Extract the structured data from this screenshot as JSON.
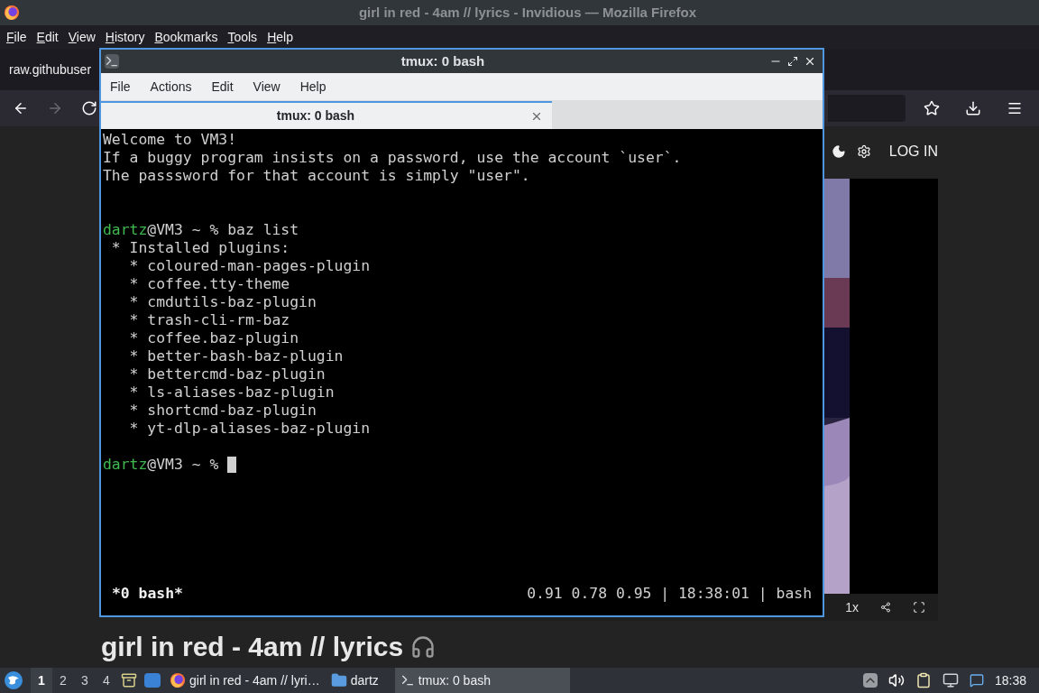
{
  "firefox": {
    "title": "girl in red - 4am // lyrics - Invidious — Mozilla Firefox",
    "menu": [
      "File",
      "Edit",
      "View",
      "History",
      "Bookmarks",
      "Tools",
      "Help"
    ],
    "tab": "raw.githubuser",
    "nav_buttons": [
      {
        "kind": "back",
        "disabled": false
      },
      {
        "kind": "forward",
        "disabled": true
      },
      {
        "kind": "reload",
        "disabled": false
      }
    ],
    "page": {
      "login": "LOG IN",
      "speed": "1x",
      "heading": "girl in red - 4am // lyrics"
    }
  },
  "terminal": {
    "title": "tmux: 0 bash",
    "menu": [
      "File",
      "Actions",
      "Edit",
      "View",
      "Help"
    ],
    "tab": {
      "label": "tmux: 0 bash",
      "selected": true
    },
    "lines": [
      {
        "kind": "output",
        "text": "Welcome to VM3!"
      },
      {
        "kind": "output",
        "text": "If a buggy program insists on a password, use the account `user`."
      },
      {
        "kind": "output",
        "text": "The passsword for that account is simply \"user\"."
      },
      {
        "kind": "blank"
      },
      {
        "kind": "blank"
      },
      {
        "kind": "prompt",
        "user": "dartz",
        "text": "@VM3 ~ % baz list",
        "cursor": false
      },
      {
        "kind": "output",
        "text": " * Installed plugins:"
      },
      {
        "kind": "output",
        "text": "   * coloured-man-pages-plugin"
      },
      {
        "kind": "output",
        "text": "   * coffee.tty-theme"
      },
      {
        "kind": "output",
        "text": "   * cmdutils-baz-plugin"
      },
      {
        "kind": "output",
        "text": "   * trash-cli-rm-baz"
      },
      {
        "kind": "output",
        "text": "   * coffee.baz-plugin"
      },
      {
        "kind": "output",
        "text": "   * better-bash-baz-plugin"
      },
      {
        "kind": "output",
        "text": "   * bettercmd-baz-plugin"
      },
      {
        "kind": "output",
        "text": "   * ls-aliases-baz-plugin"
      },
      {
        "kind": "output",
        "text": "   * shortcmd-baz-plugin"
      },
      {
        "kind": "output",
        "text": "   * yt-dlp-aliases-baz-plugin"
      },
      {
        "kind": "blank"
      },
      {
        "kind": "prompt",
        "user": "dartz",
        "text": "@VM3 ~ % ",
        "cursor": true
      }
    ],
    "status": {
      "window": "*0 bash*",
      "right": "0.91 0.78 0.95 | 18:38:01 | bash"
    }
  },
  "taskbar": {
    "workspaces": [
      {
        "label": "1",
        "selected": true
      },
      {
        "label": "2",
        "selected": false
      },
      {
        "label": "3",
        "selected": false
      },
      {
        "label": "4",
        "selected": false
      }
    ],
    "tasks": [
      {
        "kind": "firefox",
        "label": "girl in red - 4am // lyri…",
        "selected": false
      },
      {
        "kind": "folder",
        "label": "dartz",
        "selected": false
      },
      {
        "kind": "terminal",
        "label": "tmux: 0 bash",
        "selected": true
      }
    ],
    "clock": "18:38"
  }
}
